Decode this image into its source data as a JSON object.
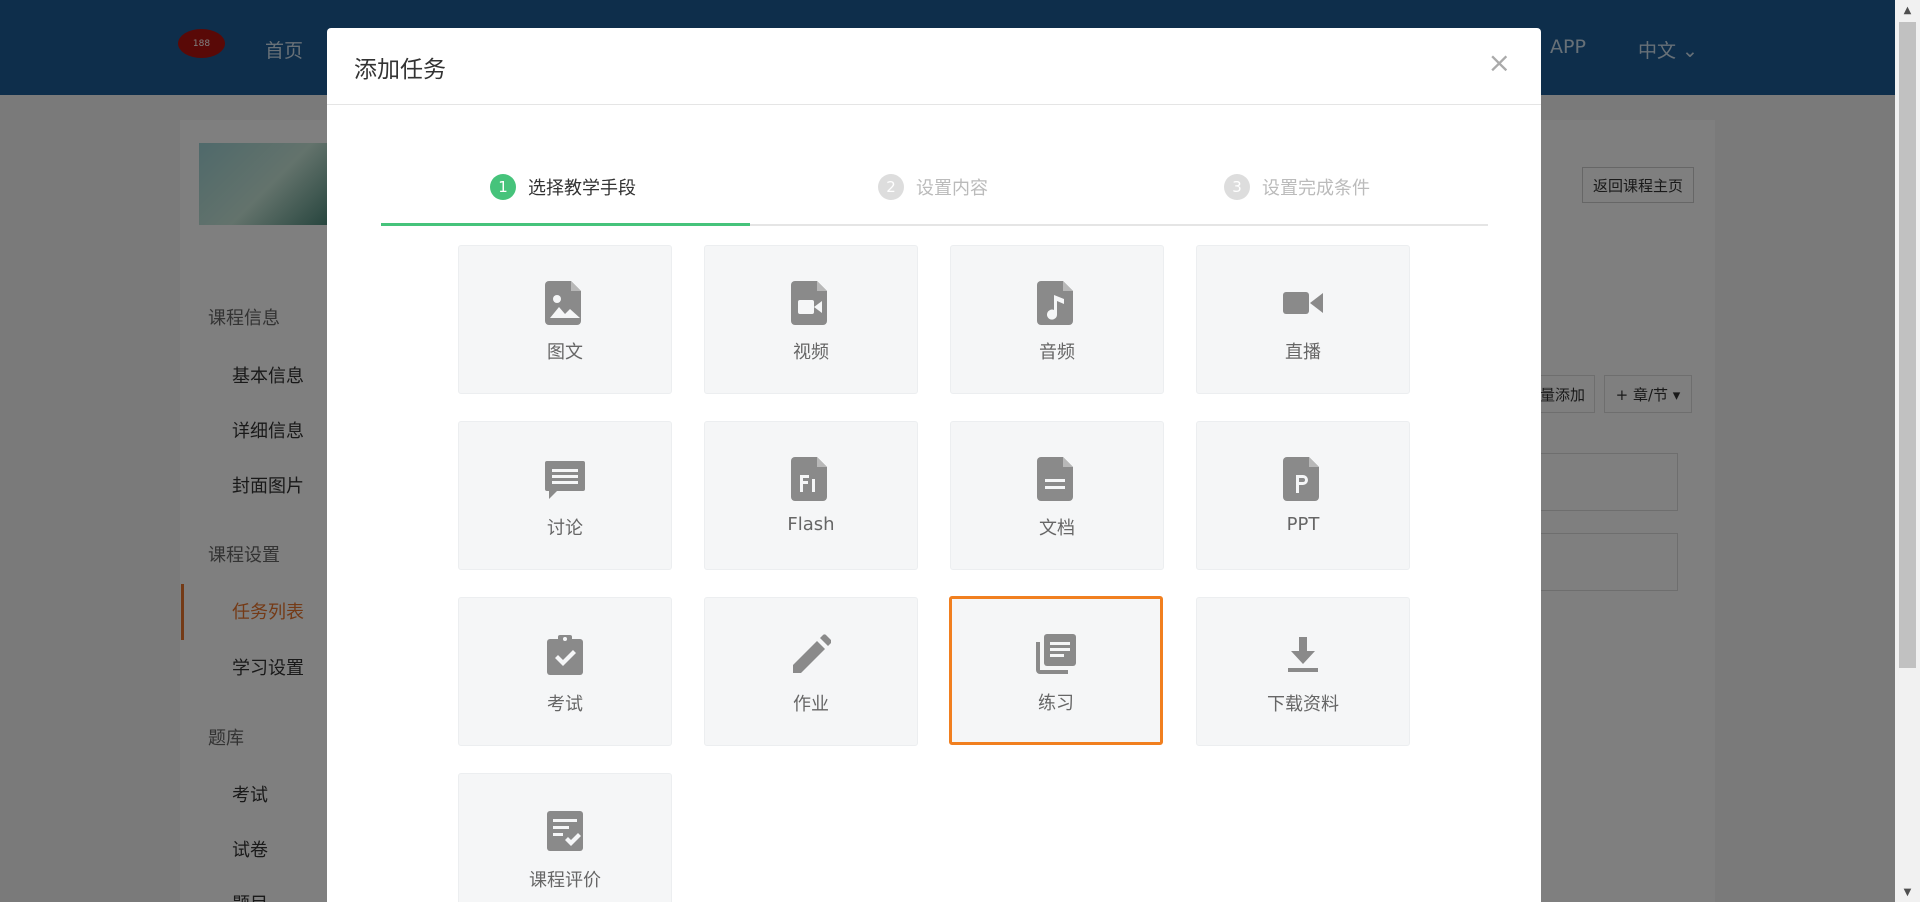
{
  "background": {
    "logo_text": "188",
    "nav_home": "首页",
    "nav_app": "APP",
    "nav_lang": "中文 ⌄",
    "return_button": "返回课程主页",
    "batch_button": "量添加",
    "chapter_button": "+ 章/节 ▾",
    "sidebar": {
      "section_course_info": "课程信息",
      "item_basic": "基本信息",
      "item_detail": "详细信息",
      "item_cover": "封面图片",
      "section_course_settings": "课程设置",
      "item_tasks": "任务列表",
      "item_study": "学习设置",
      "section_bank": "题库",
      "item_exam": "考试",
      "item_paper": "试卷",
      "item_question": "题目"
    }
  },
  "modal": {
    "title": "添加任务",
    "close": "×",
    "steps": [
      {
        "num": "1",
        "label": "选择教学手段"
      },
      {
        "num": "2",
        "label": "设置内容"
      },
      {
        "num": "3",
        "label": "设置完成条件"
      }
    ],
    "tiles": [
      {
        "label": "图文",
        "icon": "image-icon"
      },
      {
        "label": "视频",
        "icon": "video-file-icon"
      },
      {
        "label": "音频",
        "icon": "audio-file-icon"
      },
      {
        "label": "直播",
        "icon": "live-camera-icon"
      },
      {
        "label": "讨论",
        "icon": "discussion-icon"
      },
      {
        "label": "Flash",
        "icon": "flash-file-icon"
      },
      {
        "label": "文档",
        "icon": "document-icon"
      },
      {
        "label": "PPT",
        "icon": "ppt-file-icon"
      },
      {
        "label": "考试",
        "icon": "exam-clipboard-icon"
      },
      {
        "label": "作业",
        "icon": "pencil-icon"
      },
      {
        "label": "练习",
        "icon": "practice-library-icon"
      },
      {
        "label": "下载资料",
        "icon": "download-icon"
      },
      {
        "label": "课程评价",
        "icon": "evaluation-icon"
      }
    ],
    "selected_tile": "练习"
  },
  "colors": {
    "topbar": "#1c5d96",
    "accent_green": "#46c37b",
    "selected_orange": "#f17f1f",
    "icon_gray": "#8a8a8a"
  }
}
